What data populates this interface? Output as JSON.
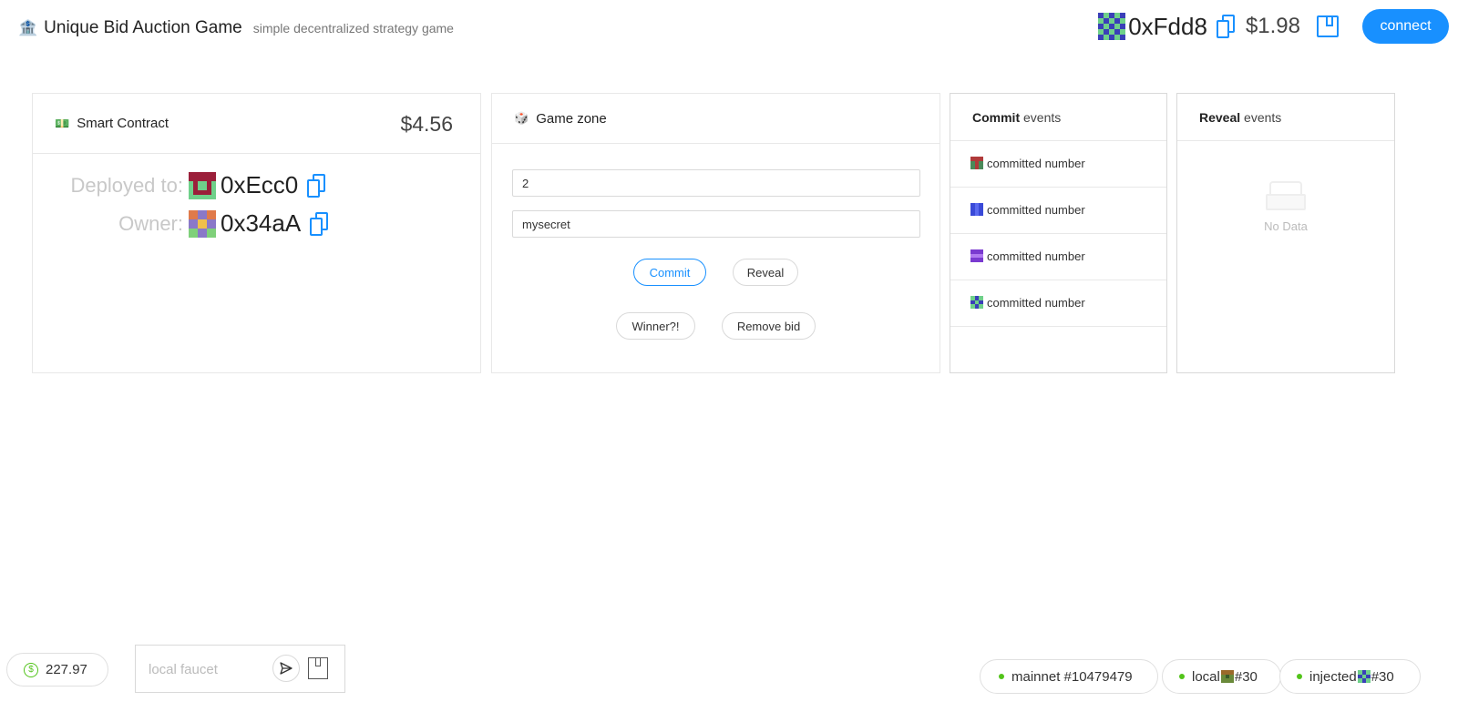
{
  "header": {
    "emoji": "🏦",
    "title": "Unique Bid Auction Game",
    "subtitle": "simple decentralized strategy game",
    "account": {
      "address": "0xFdd8",
      "balance": "$1.98"
    },
    "connect_label": "connect"
  },
  "contract_card": {
    "emoji": "💵",
    "title": "Smart Contract",
    "balance": "$4.56",
    "deployed_label": "Deployed to:",
    "deployed_address": "0xEcc0",
    "owner_label": "Owner:",
    "owner_address": "0x34aA"
  },
  "game_card": {
    "emoji": "🎲",
    "title": "Game zone",
    "bid_value": "2",
    "secret_value": "mysecret",
    "commit_label": "Commit",
    "reveal_label": "Reveal",
    "winner_label": "Winner?!",
    "remove_label": "Remove bid"
  },
  "commit_events": {
    "title_bold": "Commit",
    "title_rest": " events",
    "items": [
      {
        "text": "committed number"
      },
      {
        "text": "committed number"
      },
      {
        "text": "committed number"
      },
      {
        "text": "committed number"
      }
    ]
  },
  "reveal_events": {
    "title_bold": "Reveal",
    "title_rest": " events",
    "empty_text": "No Data"
  },
  "footer": {
    "gas_price": "227.97",
    "faucet_placeholder": "local faucet",
    "networks": [
      {
        "label": "mainnet #10479479"
      },
      {
        "label": "local",
        "suffix": "#30"
      },
      {
        "label": "injected",
        "suffix": "#30"
      }
    ]
  },
  "colors": {
    "primary": "#1890ff",
    "status_green": "#52c41a"
  }
}
